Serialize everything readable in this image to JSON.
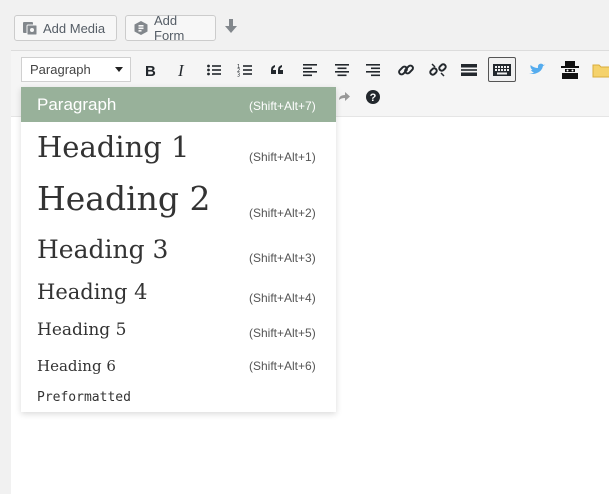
{
  "media_buttons": {
    "add_media_label": "Add Media",
    "add_form_label": "Add Form"
  },
  "toolbar": {
    "format_select_value": "Paragraph"
  },
  "format_menu": {
    "items": [
      {
        "label": "Paragraph",
        "shortcut": "(Shift+Alt+7)"
      },
      {
        "label": "Heading 1",
        "shortcut": "(Shift+Alt+1)"
      },
      {
        "label": "Heading 2",
        "shortcut": "(Shift+Alt+2)"
      },
      {
        "label": "Heading 3",
        "shortcut": "(Shift+Alt+3)"
      },
      {
        "label": "Heading 4",
        "shortcut": "(Shift+Alt+4)"
      },
      {
        "label": "Heading 5",
        "shortcut": "(Shift+Alt+5)"
      },
      {
        "label": "Heading 6",
        "shortcut": "(Shift+Alt+6)"
      },
      {
        "label": "Preformatted",
        "shortcut": ""
      }
    ],
    "selected_index": 0
  },
  "colors": {
    "selected_bg": "#98b19a",
    "twitter_blue": "#55acee",
    "folder_yellow": "#f5d26b"
  },
  "icons": [
    "media-icon",
    "form-icon",
    "down-arrow-icon",
    "bold-icon",
    "italic-icon",
    "bullet-list-icon",
    "numbered-list-icon",
    "blockquote-icon",
    "align-left-icon",
    "align-center-icon",
    "align-right-icon",
    "link-icon",
    "unlink-icon",
    "read-more-icon",
    "toolbar-toggle-icon",
    "twitter-icon",
    "spy-icon",
    "folder-icon",
    "redo-icon",
    "help-icon"
  ]
}
